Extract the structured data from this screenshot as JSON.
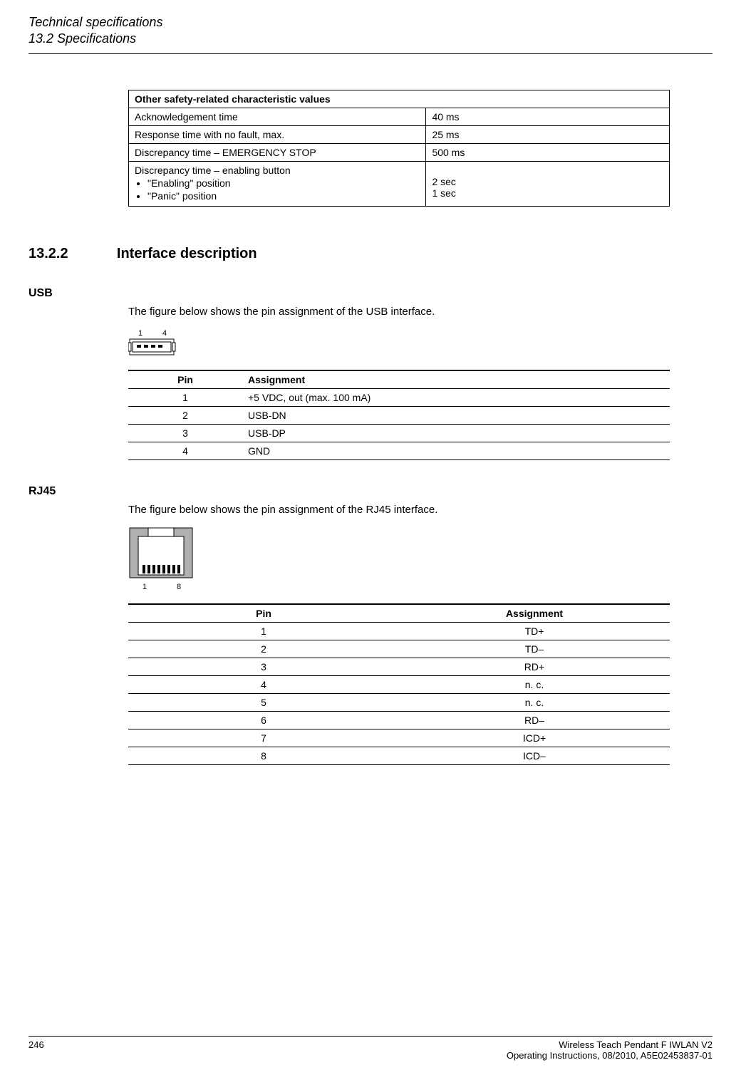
{
  "header": {
    "line1": "Technical specifications",
    "line2": "13.2 Specifications"
  },
  "safety_table": {
    "title": "Other safety-related characteristic values",
    "rows": {
      "ack_label": "Acknowledgement time",
      "ack_val": "40 ms",
      "resp_label": "Response time with no fault, max.",
      "resp_val": "25 ms",
      "disc_estop_label": "Discrepancy time – EMERGENCY STOP",
      "disc_estop_val": "500 ms",
      "disc_enable_label": "Discrepancy time – enabling button",
      "enabling_pos_label": "\"Enabling\" position",
      "panic_pos_label": "\"Panic\" position",
      "enabling_val": "2 sec",
      "panic_val": "1 sec"
    }
  },
  "section": {
    "number": "13.2.2",
    "title": "Interface description"
  },
  "usb": {
    "heading": "USB",
    "intro": "The figure below shows the pin assignment of the USB interface.",
    "pin_label_1": "1",
    "pin_label_4": "4",
    "table": {
      "col_pin": "Pin",
      "col_assign": "Assignment",
      "rows": [
        {
          "pin": "1",
          "assign": "+5 VDC, out (max. 100 mA)"
        },
        {
          "pin": "2",
          "assign": "USB-DN"
        },
        {
          "pin": "3",
          "assign": "USB-DP"
        },
        {
          "pin": "4",
          "assign": "GND"
        }
      ]
    }
  },
  "rj45": {
    "heading": "RJ45",
    "intro": "The figure below shows the pin assignment of the RJ45 interface.",
    "pin_label_1": "1",
    "pin_label_8": "8",
    "table": {
      "col_pin": "Pin",
      "col_assign": "Assignment",
      "rows": [
        {
          "pin": "1",
          "assign": "TD+"
        },
        {
          "pin": "2",
          "assign": "TD–"
        },
        {
          "pin": "3",
          "assign": "RD+"
        },
        {
          "pin": "4",
          "assign": "n. c."
        },
        {
          "pin": "5",
          "assign": "n. c."
        },
        {
          "pin": "6",
          "assign": "RD–"
        },
        {
          "pin": "7",
          "assign": "ICD+"
        },
        {
          "pin": "8",
          "assign": "ICD–"
        }
      ]
    }
  },
  "footer": {
    "page": "246",
    "right1": "Wireless Teach Pendant F IWLAN V2",
    "right2": "Operating Instructions, 08/2010, A5E02453837-01"
  }
}
